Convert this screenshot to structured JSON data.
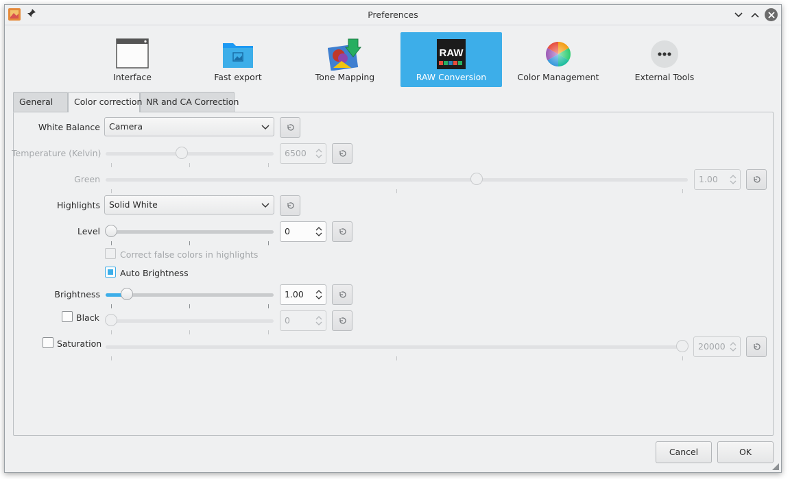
{
  "window": {
    "title": "Preferences"
  },
  "pages": [
    {
      "label": "Interface",
      "icon": "window-icon"
    },
    {
      "label": "Fast export",
      "icon": "image-folder-icon"
    },
    {
      "label": "Tone Mapping",
      "icon": "tone-mapping-icon"
    },
    {
      "label": "RAW Conversion",
      "icon": "raw-icon",
      "icon_text": "RAW",
      "active": true
    },
    {
      "label": "Color Management",
      "icon": "color-wheel-icon"
    },
    {
      "label": "External Tools",
      "icon": "more-icon"
    }
  ],
  "tabs": [
    {
      "label": "General"
    },
    {
      "label": "Color correction",
      "active": true
    },
    {
      "label": "NR and CA Correction"
    }
  ],
  "form": {
    "white_balance": {
      "label": "White Balance",
      "value": "Camera"
    },
    "temperature": {
      "label": "Temperature (Kelvin)",
      "value": "6500",
      "position": 0.45,
      "enabled": false
    },
    "green": {
      "label": "Green",
      "value": "1.00",
      "position": 0.64,
      "enabled": false
    },
    "highlights": {
      "label": "Highlights",
      "value": "Solid White"
    },
    "level": {
      "label": "Level",
      "value": "0",
      "position": 0.0,
      "enabled": true
    },
    "correct_false_colors": {
      "label": "Correct false colors in highlights",
      "checked": false,
      "enabled": false
    },
    "auto_brightness": {
      "label": "Auto Brightness",
      "checked": true,
      "enabled": true
    },
    "brightness": {
      "label": "Brightness",
      "value": "1.00",
      "position": 0.1,
      "enabled": true
    },
    "black": {
      "label": "Black",
      "value": "0",
      "position": 0.0,
      "checked": false,
      "enabled": false
    },
    "saturation": {
      "label": "Saturation",
      "value": "20000",
      "position": 1.0,
      "checked": false,
      "enabled": false
    }
  },
  "buttons": {
    "cancel": "Cancel",
    "ok": "OK"
  },
  "colors": {
    "accent": "#3daee9",
    "window_bg": "#eff0f1",
    "disabled_text": "#a5a8ab"
  }
}
